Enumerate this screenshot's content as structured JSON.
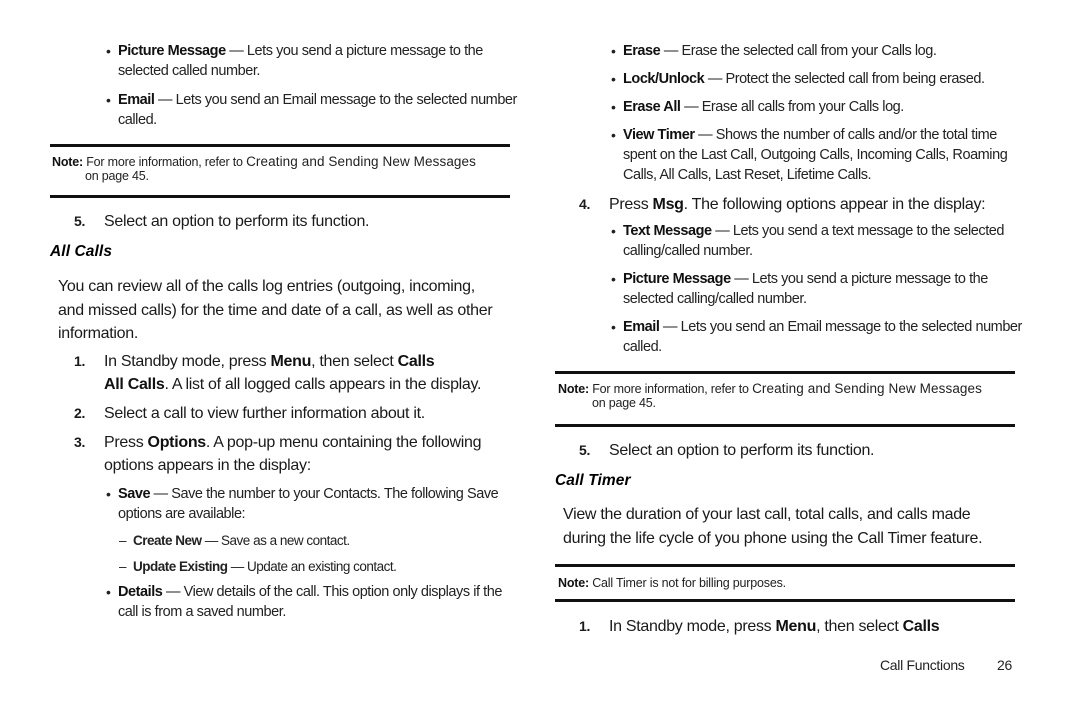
{
  "left_column": {
    "msg_options": [
      {
        "term": "Picture Message",
        "desc": " — Lets you send a picture message to the",
        "desc2": "selected called number."
      },
      {
        "term": "Email",
        "desc": " — Lets you send an Email message to the selected number",
        "desc2": "called."
      }
    ],
    "note1": {
      "label": "Note:",
      "text": " For more information, refer to ",
      "ref": "Creating and Sending New Messages",
      "text2": "on page 45."
    },
    "step5": {
      "num": "5.",
      "text": "Select an option to perform its function."
    },
    "all_calls": {
      "heading": "All Calls",
      "intro": [
        "You can review all of the calls log entries (outgoing, incoming,",
        "and missed calls) for the time and date of a call, as well as other",
        "information."
      ],
      "steps": [
        {
          "num": "1.",
          "pre": "In Standby mode, press ",
          "b1": "Menu",
          "mid": ", then select ",
          "b2": "Calls",
          "line2_b": "All Calls",
          "line2": ". A list of all logged calls appears in the display."
        },
        {
          "num": "2.",
          "text": "Select a call to view further information about it."
        },
        {
          "num": "3.",
          "pre": "Press ",
          "b1": "Options",
          "post": ". A pop-up menu containing the following",
          "line2": "options appears in the display:"
        }
      ],
      "options": [
        {
          "term": "Save",
          "desc": " — Save the number to your Contacts. The following Save",
          "desc2": "options are available:"
        },
        {
          "term": "Details",
          "desc": " — View details of the call. This option only displays if the",
          "desc2": "call is from a saved number."
        }
      ],
      "save_options": [
        {
          "term": "Create New",
          "desc": " — Save as a new contact."
        },
        {
          "term": "Update Existing",
          "desc": " — Update an existing contact."
        }
      ]
    }
  },
  "right_column": {
    "options": [
      {
        "term": "Erase",
        "desc": " — Erase the selected call from your Calls log."
      },
      {
        "term": "Lock/Unlock",
        "desc": " — Protect the selected call from being erased."
      },
      {
        "term": "Erase All",
        "desc": " — Erase all calls from your Calls log."
      },
      {
        "term": "View Timer",
        "desc": " — Shows the number of calls and/or the total time",
        "desc2": "spent on the Last Call, Outgoing Calls, Incoming Calls, Roaming",
        "desc3": "Calls, All Calls, Last Reset, Lifetime Calls."
      }
    ],
    "step4": {
      "num": "4.",
      "pre": "Press ",
      "b1": "Msg",
      "post": ". The following options appear in the display:"
    },
    "msg_options": [
      {
        "term": "Text Message",
        "desc": " — Lets you send a text message to the selected",
        "desc2": "calling/called number."
      },
      {
        "term": "Picture Message",
        "desc": " — Lets you send a picture message to the",
        "desc2": "selected calling/called number."
      },
      {
        "term": "Email",
        "desc": " — Lets you send an Email message to the selected number",
        "desc2": "called."
      }
    ],
    "note2": {
      "label": "Note:",
      "text": " For more information, refer to ",
      "ref": "Creating and Sending New Messages",
      "text2": "on page 45."
    },
    "step5": {
      "num": "5.",
      "text": "Select an option to perform its function."
    },
    "call_timer": {
      "heading": "Call Timer",
      "intro": [
        "View the duration of your last call, total calls, and calls made",
        "during the life cycle of you phone using the Call Timer feature."
      ],
      "note": {
        "label": "Note:",
        "text": " Call Timer is not for billing purposes."
      },
      "step1": {
        "num": "1.",
        "pre": "In Standby mode, press ",
        "b1": "Menu",
        "mid": ", then select ",
        "b2": "Calls"
      }
    }
  },
  "footer": {
    "section": "Call Functions",
    "page_number": "26"
  }
}
